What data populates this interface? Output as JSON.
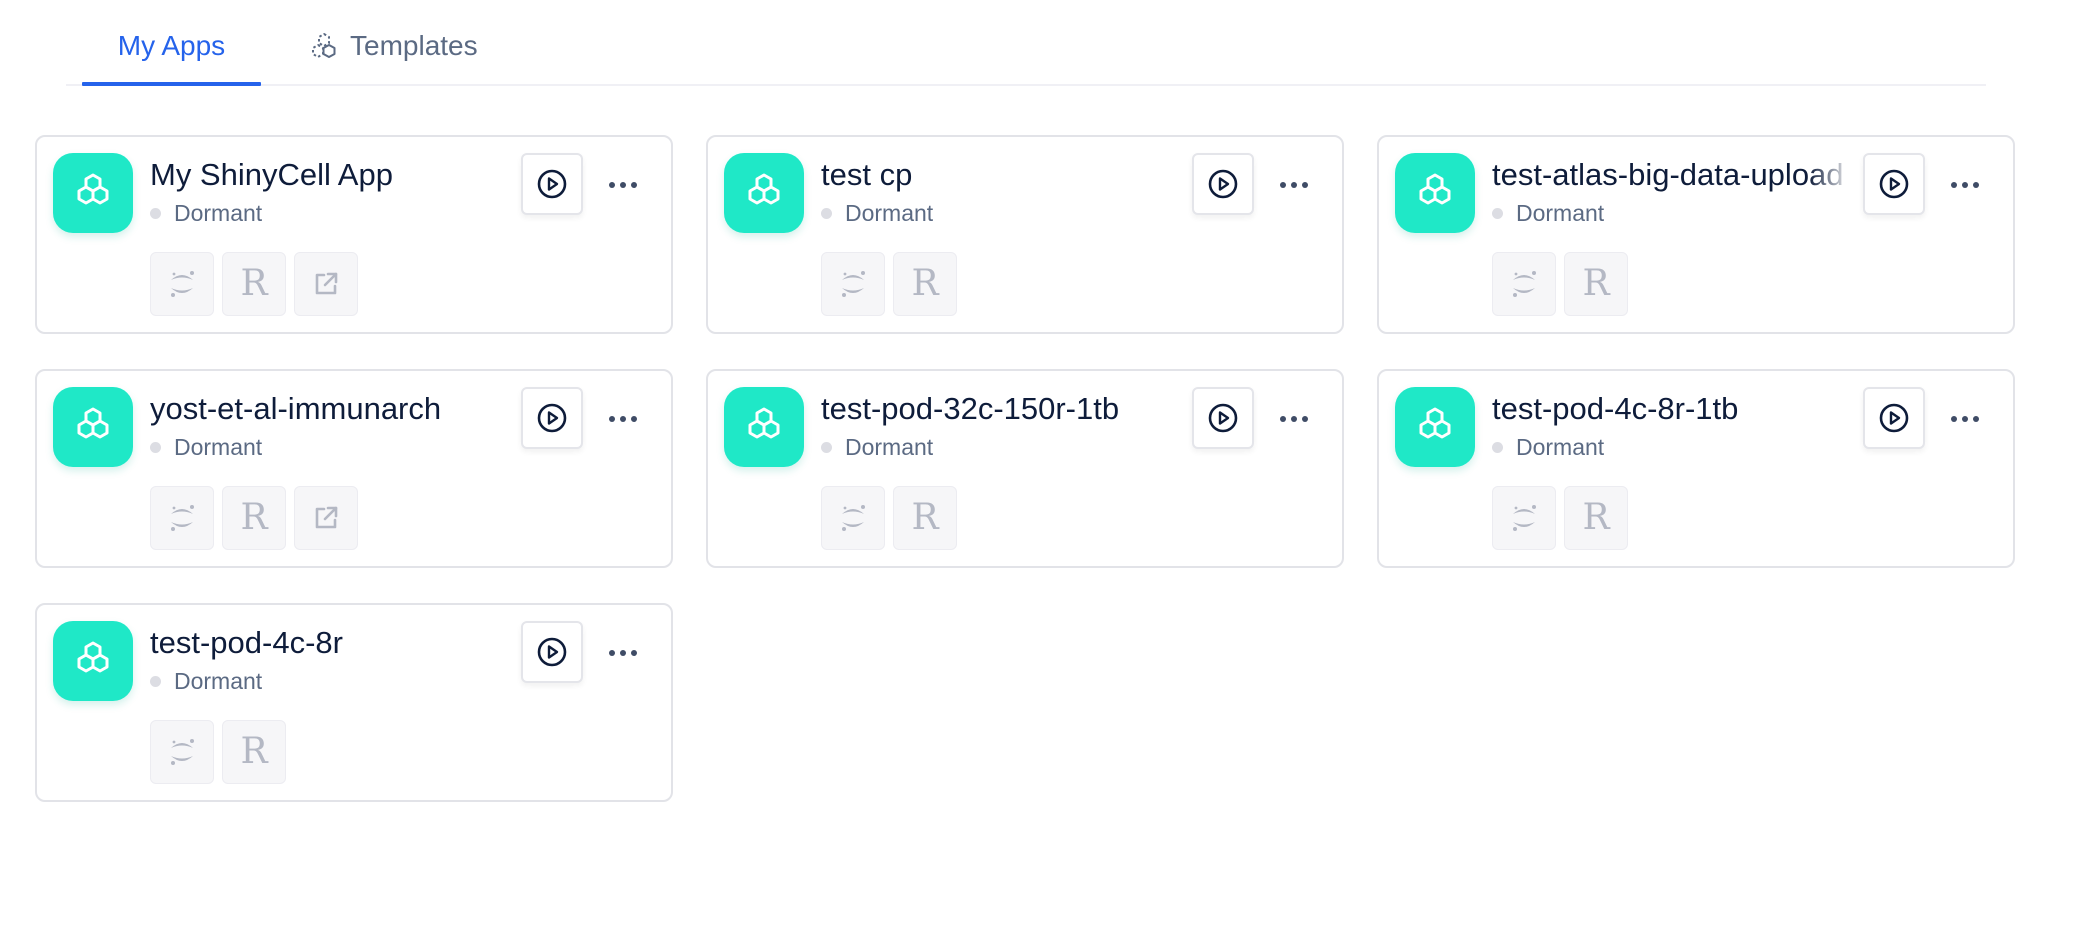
{
  "tabs": [
    {
      "label": "My Apps",
      "active": true,
      "icon": null
    },
    {
      "label": "Templates",
      "active": false,
      "icon": "hexagon-cluster-dashed-icon"
    }
  ],
  "colors": {
    "accent": "#2563eb",
    "app_icon_bg": "#1fe8c7",
    "title_text": "#0e1c3a",
    "status_text": "#5b6a83",
    "status_dot_dormant": "#dcdde3",
    "tool_icon": "#b4b8c4"
  },
  "apps": [
    {
      "name": "My ShinyCell App",
      "status": "Dormant",
      "tools": [
        "jupyter",
        "r",
        "external-link"
      ],
      "tool_labels": {
        "r": "R"
      }
    },
    {
      "name": "test cp",
      "status": "Dormant",
      "tools": [
        "jupyter",
        "r"
      ],
      "tool_labels": {
        "r": "R"
      }
    },
    {
      "name": "test-atlas-big-data-upload",
      "status": "Dormant",
      "tools": [
        "jupyter",
        "r"
      ],
      "tool_labels": {
        "r": "R"
      }
    },
    {
      "name": "yost-et-al-immunarch",
      "status": "Dormant",
      "tools": [
        "jupyter",
        "r",
        "external-link"
      ],
      "tool_labels": {
        "r": "R"
      }
    },
    {
      "name": "test-pod-32c-150r-1tb",
      "status": "Dormant",
      "tools": [
        "jupyter",
        "r"
      ],
      "tool_labels": {
        "r": "R"
      }
    },
    {
      "name": "test-pod-4c-8r-1tb",
      "status": "Dormant",
      "tools": [
        "jupyter",
        "r"
      ],
      "tool_labels": {
        "r": "R"
      }
    },
    {
      "name": "test-pod-4c-8r",
      "status": "Dormant",
      "tools": [
        "jupyter",
        "r"
      ],
      "tool_labels": {
        "r": "R"
      }
    }
  ],
  "icons": {
    "app": "hexagon-cluster-icon",
    "play": "play-circle-icon",
    "more": "more-horizontal-icon",
    "jupyter": "jupyter-icon",
    "r": "r-language-icon",
    "external-link": "external-link-icon"
  }
}
